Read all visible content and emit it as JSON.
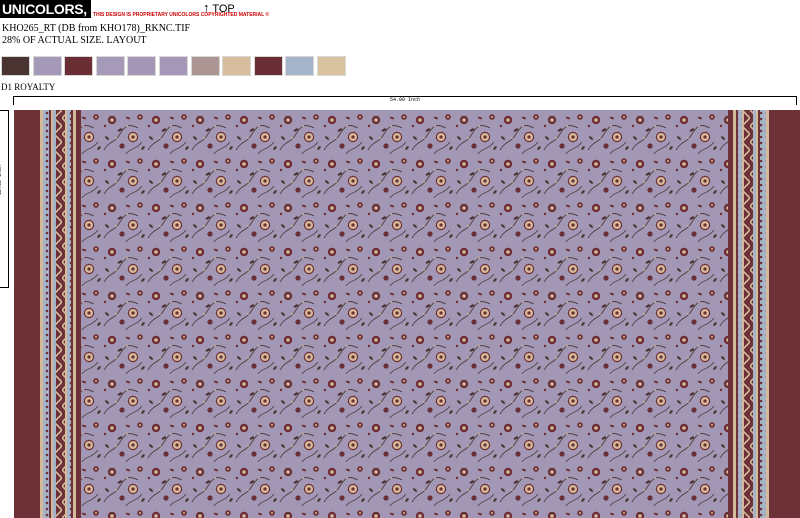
{
  "header": {
    "logo_text": "UNICOLORS, INC.",
    "notice": "THIS DESIGN IS PROPRIETARY UNICOLORS COPYRIGHTED MATERIAL ©",
    "top_link": "TOP",
    "top_arrow": "↑"
  },
  "design": {
    "filename": "KHO265_RT (DB from KHO178)_RKNC.TIF",
    "scale_note": "28% OF ACTUAL SIZE. LAYOUT",
    "colorway": "D1 ROYALTY",
    "width_label": "54.00 Inch",
    "repeat_label": "12.62 Inch"
  },
  "swatches": [
    "#4a3432",
    "#a599b8",
    "#6b2e35",
    "#a69ab9",
    "#a497b6",
    "#a597b7",
    "#ac9693",
    "#d6bd9e",
    "#6a2f36",
    "#a5b4c8",
    "#d8c2a0"
  ],
  "colors": {
    "ground": "#a297b4",
    "border": "#6d3138",
    "motif_dark": "#6b2e35",
    "motif_mid": "#4a3432",
    "motif_tan": "#d4ba9a",
    "stripe_blue": "#a5b4c8"
  }
}
